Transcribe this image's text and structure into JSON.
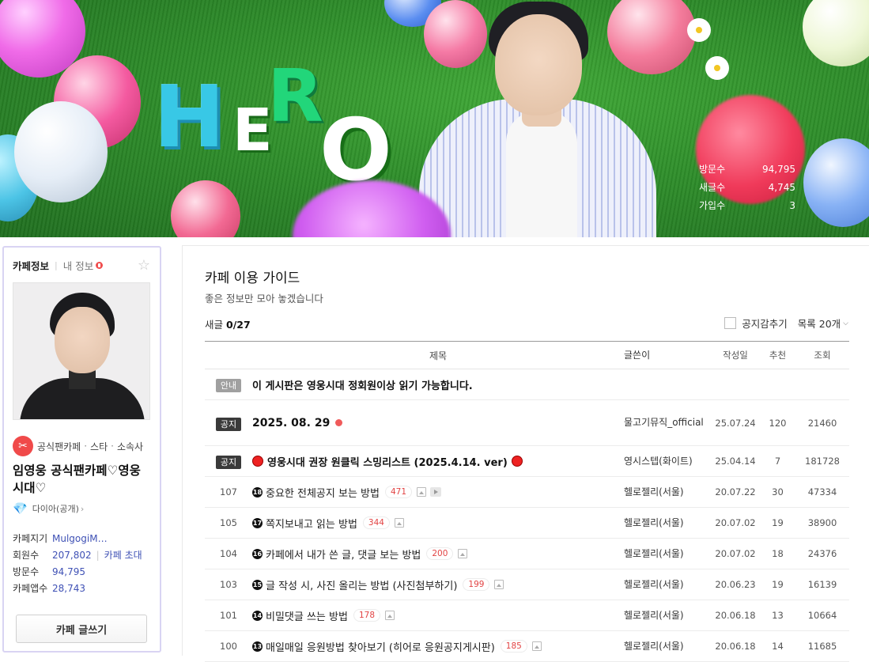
{
  "banner": {
    "hero_letters": [
      "H",
      "E",
      "R",
      "O"
    ],
    "stats": [
      {
        "label": "방문수",
        "value": "94,795"
      },
      {
        "label": "새글수",
        "value": "4,745"
      },
      {
        "label": "가입수",
        "value": "3"
      }
    ]
  },
  "sidebar": {
    "tab_cafe_info": "카페정보",
    "tab_my_info": "내 정보",
    "category_icon": "cafe-category-icon",
    "category": "공식팬카페",
    "category_sub1": "스타",
    "category_sub2": "소속사",
    "cafe_name": "임영웅 공식팬카페♡영웅시대♡",
    "grade": "다이아(공개)",
    "info": {
      "manager_label": "카페지기",
      "manager_value": "MulgogiMusi..",
      "members_label": "회원수",
      "members_value": "207,802",
      "invite_label": "카페 초대",
      "visits_label": "방문수",
      "visits_value": "94,795",
      "app_label": "카페앱수",
      "app_value": "28,743"
    },
    "write_button": "카페 글쓰기"
  },
  "main": {
    "title": "카페 이용 가이드",
    "description": "좋은 정보만 모아 놓겠습니다",
    "new_label": "새글",
    "new_value": "0/27",
    "hide_notice": "공지감추기",
    "list_size": "목록 20개",
    "columns": {
      "title": "제목",
      "author": "글쓴이",
      "date": "작성일",
      "rec": "추천",
      "views": "조회"
    },
    "rows": [
      {
        "badge": "안내",
        "title": "이 게시판은 영웅시대 정회원이상 읽기 가능합니다."
      },
      {
        "badge": "공지",
        "title": "2025. 08. 29",
        "author": "물고기뮤직_official",
        "date": "25.07.24",
        "rec": "120",
        "views": "21460"
      },
      {
        "badge": "공지",
        "title": "영웅시대 권장 원클릭 스밍리스트 (2025.4.14. ver)",
        "author": "영시스텝(화이트)",
        "date": "25.04.14",
        "rec": "7",
        "views": "181728"
      },
      {
        "no": "107",
        "circ": "18",
        "title": "중요한 전체공지 보는 방법",
        "comments": "471",
        "author": "헬로젤리(서울)",
        "date": "20.07.22",
        "rec": "30",
        "views": "47334"
      },
      {
        "no": "105",
        "circ": "17",
        "title": "쪽지보내고 읽는 방법",
        "comments": "344",
        "author": "헬로젤리(서울)",
        "date": "20.07.02",
        "rec": "19",
        "views": "38900"
      },
      {
        "no": "104",
        "circ": "16",
        "title": "카페에서 내가 쓴 글, 댓글 보는 방법",
        "comments": "200",
        "author": "헬로젤리(서울)",
        "date": "20.07.02",
        "rec": "18",
        "views": "24376"
      },
      {
        "no": "103",
        "circ": "15",
        "title": "글 작성 시, 사진 올리는 방법 (사진첨부하기)",
        "comments": "199",
        "author": "헬로젤리(서울)",
        "date": "20.06.23",
        "rec": "19",
        "views": "16139"
      },
      {
        "no": "101",
        "circ": "14",
        "title": "비밀댓글 쓰는 방법",
        "comments": "178",
        "author": "헬로젤리(서울)",
        "date": "20.06.18",
        "rec": "13",
        "views": "10664"
      },
      {
        "no": "100",
        "circ": "13",
        "title": "매일매일 응원방법 찾아보기 (히어로 응원공지게시판)",
        "comments": "185",
        "author": "헬로젤리(서울)",
        "date": "20.06.18",
        "rec": "14",
        "views": "11685"
      }
    ]
  }
}
